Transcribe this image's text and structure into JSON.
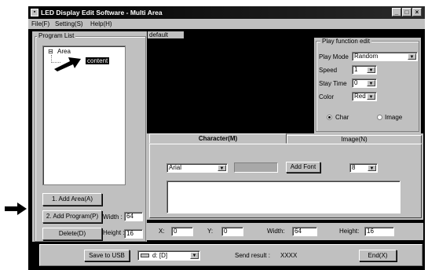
{
  "window": {
    "icon": "app-icon",
    "title": "LED Display Edit Software - Multi Area",
    "min_glyph": "_",
    "max_glyph": "□",
    "close_glyph": "×"
  },
  "menu": [
    "File(F)",
    "Setting(S)",
    "Help(H)"
  ],
  "program_list": {
    "title": "Program List",
    "tree_root_toggle": "⊟",
    "tree_root": "Area",
    "tree_child": "content",
    "add_area_label": "1. Add Area(A)",
    "add_program_label": "2. Add Program(P)",
    "delete_label": "Delete(D)",
    "width_label": "Width :",
    "width_value": "64",
    "height_label": "Height :",
    "height_value": "16"
  },
  "preview": {
    "tab_label": "default"
  },
  "play_function": {
    "title": "Play function edit",
    "play_mode_label": "Play Mode",
    "play_mode_value": "Random",
    "speed_label": "Speed",
    "speed_value": "1",
    "stay_time_label": "Stay Time",
    "stay_time_value": "0",
    "color_label": "Color",
    "color_value": "Red",
    "radio_char": "Char",
    "radio_image": "Image",
    "selected": "Char"
  },
  "editor": {
    "tab_character": "Character(M)",
    "tab_image": "Image(N)",
    "font_value": "Arial",
    "add_font_label": "Add Font",
    "size_value": "8",
    "text_value": ""
  },
  "coords": {
    "x_label": "X:",
    "x_value": "0",
    "y_label": "Y:",
    "y_value": "0",
    "width_label": "Width:",
    "width_value": "64",
    "height_label": "Height:",
    "height_value": "16"
  },
  "footer": {
    "save_usb_label": "Save to USB",
    "drive_value": "d: [D]",
    "send_result_label": "Send result :",
    "send_result_value": "XXXX",
    "end_label": "End(X)"
  },
  "annotations": {
    "arrow_tree": "arrow-pointing-to-content",
    "arrow_add_program": "arrow-pointing-to-add-program"
  }
}
